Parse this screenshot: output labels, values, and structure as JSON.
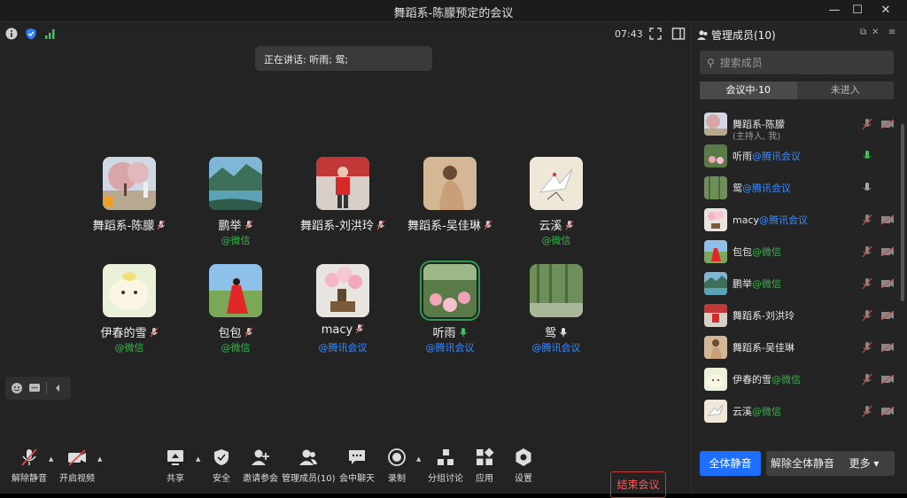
{
  "window": {
    "title": "舞蹈系-陈朦预定的会议"
  },
  "topbar": {
    "time": "07:43"
  },
  "speaking": {
    "text": "正在讲话: 听雨; 鸳;"
  },
  "participants": [
    {
      "name": "舞蹈系-陈朦",
      "source": ""
    },
    {
      "name": "鹏举",
      "source": "@微信"
    },
    {
      "name": "舞蹈系-刘洪玲",
      "source": ""
    },
    {
      "name": "舞蹈系-吴佳琳",
      "source": ""
    },
    {
      "name": "云溪",
      "source": "@微信"
    },
    {
      "name": "伊春的雪",
      "source": "@微信"
    },
    {
      "name": "包包",
      "source": "@微信"
    },
    {
      "name": "macy",
      "source": "@腾讯会议"
    },
    {
      "name": "听雨",
      "source": "@腾讯会议"
    },
    {
      "name": "鸳",
      "source": "@腾讯会议"
    }
  ],
  "toolbar": {
    "unmute": "解除静音",
    "video": "开启视频",
    "share": "共享",
    "security": "安全",
    "invite": "邀请参会",
    "manage": "管理成员(10)",
    "chat": "会中聊天",
    "record": "录制",
    "breakout": "分组讨论",
    "apps": "应用",
    "settings": "设置",
    "end": "结束会议"
  },
  "panel": {
    "title": "管理成员(10)",
    "search_placeholder": "搜索成员",
    "tab_in": "会议中·10",
    "tab_out": "未进入",
    "members": [
      {
        "name": "舞蹈系-陈朦",
        "tag": "",
        "sub": "(主持人, 我)"
      },
      {
        "name": "听雨",
        "tag": "@腾讯会议",
        "sub": ""
      },
      {
        "name": "鸳",
        "tag": "@腾讯会议",
        "sub": ""
      },
      {
        "name": "macy",
        "tag": "@腾讯会议",
        "sub": ""
      },
      {
        "name": "包包",
        "tag": "@微信",
        "sub": ""
      },
      {
        "name": "鹏举",
        "tag": "@微信",
        "sub": ""
      },
      {
        "name": "舞蹈系-刘洪玲",
        "tag": "",
        "sub": ""
      },
      {
        "name": "舞蹈系-吴佳琳",
        "tag": "",
        "sub": ""
      },
      {
        "name": "伊春的雪",
        "tag": "@微信",
        "sub": ""
      },
      {
        "name": "云溪",
        "tag": "@微信",
        "sub": ""
      }
    ],
    "mute_all": "全体静音",
    "unmute_all": "解除全体静音",
    "more": "更多 ▾"
  },
  "colors": {
    "accent": "#1e6fff",
    "end": "#c23a3a",
    "wechat": "#37b34a",
    "tencent": "#3b8cff"
  }
}
